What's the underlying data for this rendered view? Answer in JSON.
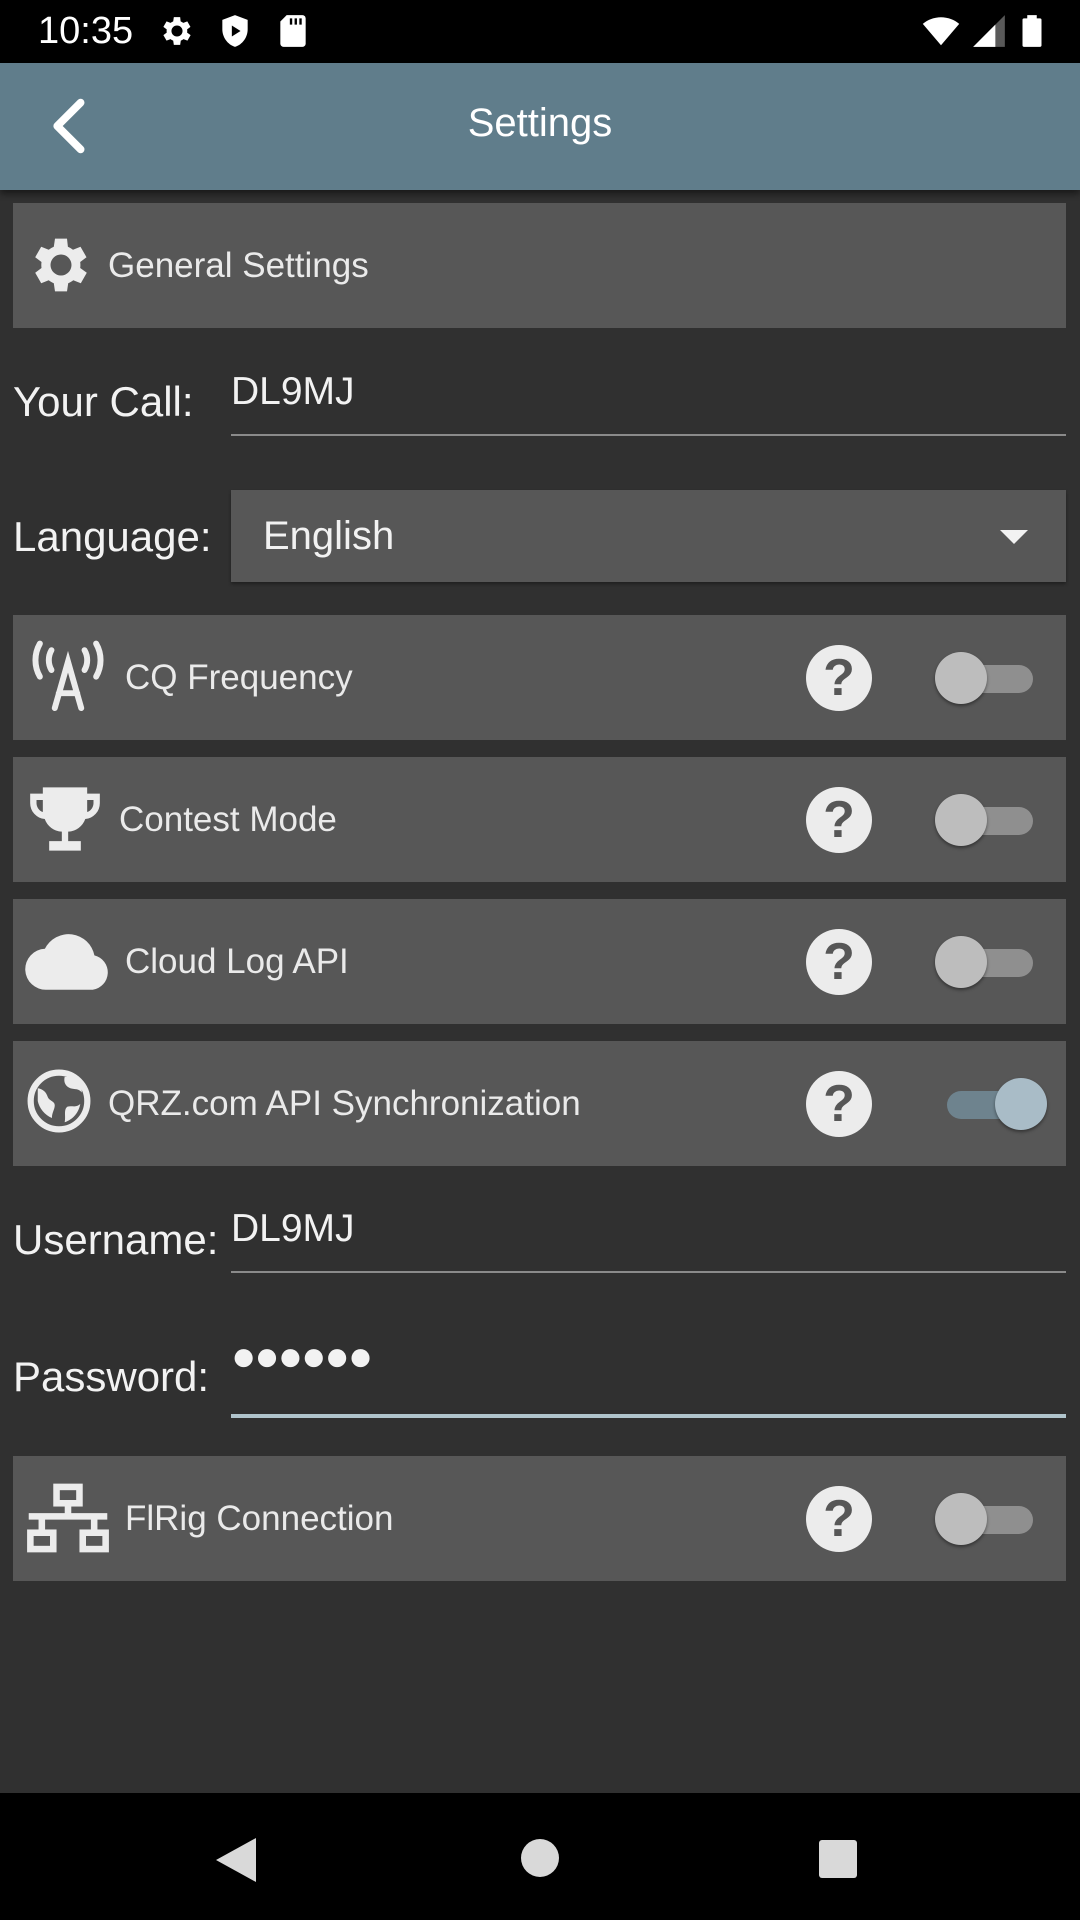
{
  "status_bar": {
    "time": "10:35"
  },
  "app_bar": {
    "title": "Settings"
  },
  "general_section": {
    "label": "General Settings"
  },
  "your_call": {
    "label": "Your Call:",
    "value": "DL9MJ"
  },
  "language": {
    "label": "Language:",
    "selected": "English"
  },
  "toggles": {
    "cq_frequency": {
      "label": "CQ Frequency",
      "enabled": false,
      "icon": "antenna-icon"
    },
    "contest_mode": {
      "label": "Contest Mode",
      "enabled": false,
      "icon": "trophy-icon"
    },
    "cloud_log_api": {
      "label": "Cloud Log API",
      "enabled": false,
      "icon": "cloud-icon"
    },
    "qrz_sync": {
      "label": "QRZ.com API Synchronization",
      "enabled": true,
      "icon": "globe-icon"
    },
    "flrig": {
      "label": "FlRig Connection",
      "enabled": false,
      "icon": "network-icon"
    }
  },
  "username": {
    "label": "Username:",
    "value": "DL9MJ"
  },
  "password": {
    "label": "Password:",
    "value": "●●●●●●"
  },
  "help_glyph": "?",
  "colors": {
    "app_bar": "#607d8b",
    "background": "#303030",
    "panel": "#575757",
    "switch_on": "#a9bcc7"
  }
}
